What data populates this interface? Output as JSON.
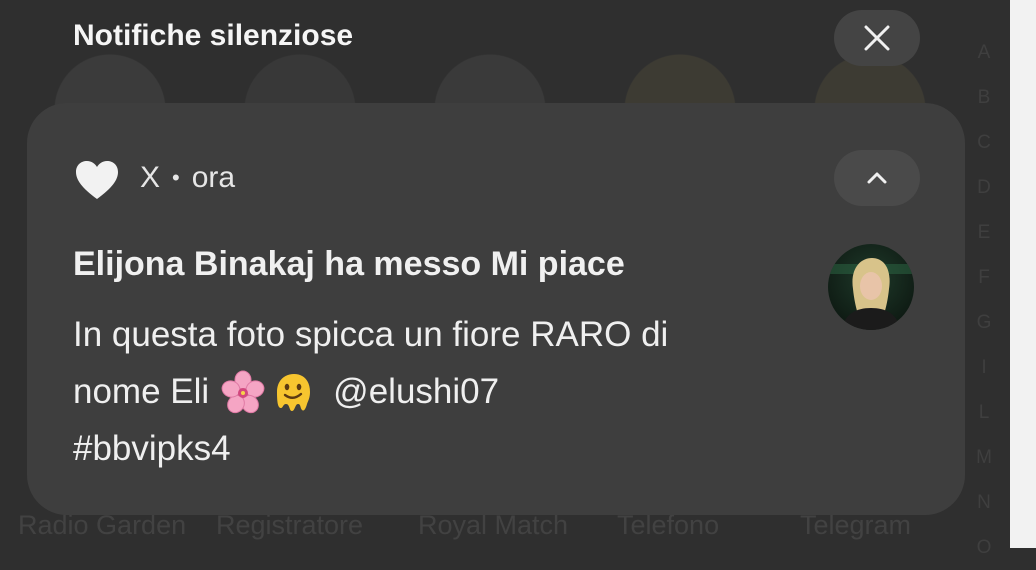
{
  "shade": {
    "title": "Notifiche silenziose",
    "close_icon": "close-icon"
  },
  "notification": {
    "app_icon": "heart-icon",
    "app_name": "X",
    "separator": "•",
    "time": "ora",
    "expand_icon": "chevron-up-icon",
    "title": "Elijona Binakaj ha messo Mi piace",
    "body_line1": "In questa foto spicca un fiore RARO di",
    "body_line2_text": "nome Eli",
    "body_line2_emojis": [
      "cherry-blossom-emoji",
      "melting-face-emoji"
    ],
    "body_line2_mention": "@elushi07",
    "body_line3": "#bbvipks4",
    "avatar": "profile-avatar"
  },
  "background": {
    "alphabet_index": [
      "A",
      "B",
      "C",
      "D",
      "E",
      "F",
      "G",
      "I",
      "L",
      "M",
      "N",
      "O"
    ],
    "app_labels": [
      "Radio Garden",
      "Registratore",
      "Royal Match",
      "Telefono",
      "Telegram"
    ]
  },
  "colors": {
    "scrim": "#2f2f2f",
    "card": "#3e3e3e",
    "button": "#444444",
    "text": "#efefef"
  }
}
